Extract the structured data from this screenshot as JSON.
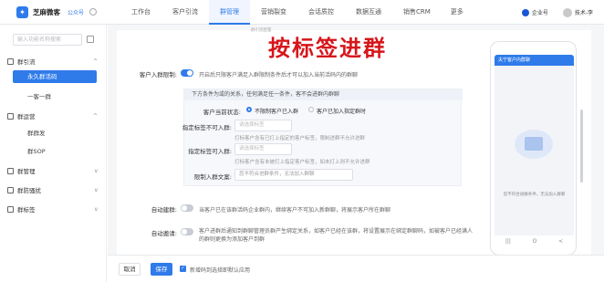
{
  "app": {
    "name": "芝麻微客",
    "sub": "公众号"
  },
  "nav": {
    "items": [
      "工作台",
      "客户引流",
      "群管理",
      "营销裂变",
      "会话质控",
      "数据互通",
      "销售CRM"
    ],
    "more": "更多",
    "active_index": 2
  },
  "header": {
    "enterprise_label": "企业号",
    "user_name": "技术-李"
  },
  "sidebar": {
    "search_placeholder": "输入功能名称搜索",
    "groups": [
      {
        "label": "群引流",
        "chevron": "^"
      },
      {
        "label": "群运营",
        "chevron": "^"
      },
      {
        "label": "群管理",
        "chevron": "v"
      },
      {
        "label": "群防骚扰",
        "chevron": "v"
      },
      {
        "label": "群标签",
        "chevron": "v"
      }
    ],
    "subs": [
      "永久群活码",
      "一客一群",
      "群群发",
      "群SOP"
    ]
  },
  "title_overlay": "按标签进群",
  "tiny_hint": "群引流配置",
  "settings": {
    "auto_join_label": "客户入群限制:",
    "auto_join_desc": "开启后只限客户满足入群限制条件后才可以加入当前活码内的群聊",
    "cond_head": "下方条件为或的关系，任何满足任一条件，客不会进群内群聊",
    "status_label": "客户当前状态:",
    "status_opt1": "不限制客户已入群",
    "status_opt2": "客户已加入指定群时",
    "tag_include_label": "指定标签不可入群:",
    "tag_include_placeholder": "请选择标签",
    "tag_include_help": "打标客户含有已打上指定的客户标签，限制进群不允许进群",
    "tag_exclude_label": "指定标签可入群:",
    "tag_exclude_placeholder": "请选择标签",
    "tag_exclude_help": "打标客户含有未被打上指定客户标签，如未打上则不允许进群",
    "reject_label": "限制入群文案:",
    "reject_placeholder": "您不符合进群条件，无法加入群聊",
    "auto_create_label": "自动建群:",
    "auto_create_desc": "当客户已在该群活码企业群内，继续客户不可加入新群聊，将展示客户所在群聊",
    "auto_welcome_label": "自动邀请:",
    "auto_welcome_desc": "客户进群后通知到群聊管理员群产生绑定关系，如客户已经在该群，将设置展示在绑定群聊码，如被客户已经满人的群则更换为添加客户到群"
  },
  "phone": {
    "title": "夫宁客户内群聊",
    "empty_text": "您不符合进群条件，无法加入群聊",
    "footer_icons": [
      "|||",
      "O",
      "<"
    ]
  },
  "footer": {
    "cancel": "取消",
    "save": "保存",
    "check_label": "新增码到选择即默认应用"
  },
  "colors": {
    "accent": "#2f7bea",
    "title_red": "#d6161b"
  }
}
